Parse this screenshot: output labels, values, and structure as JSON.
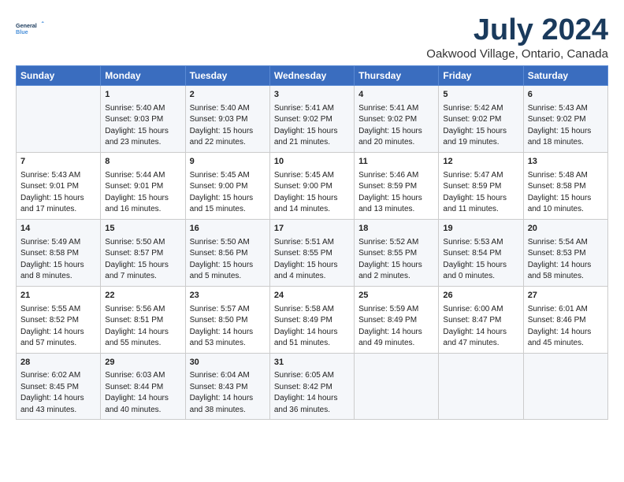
{
  "logo": {
    "line1": "General",
    "line2": "Blue"
  },
  "title": "July 2024",
  "subtitle": "Oakwood Village, Ontario, Canada",
  "headers": [
    "Sunday",
    "Monday",
    "Tuesday",
    "Wednesday",
    "Thursday",
    "Friday",
    "Saturday"
  ],
  "weeks": [
    [
      {
        "day": "",
        "lines": []
      },
      {
        "day": "1",
        "lines": [
          "Sunrise: 5:40 AM",
          "Sunset: 9:03 PM",
          "Daylight: 15 hours",
          "and 23 minutes."
        ]
      },
      {
        "day": "2",
        "lines": [
          "Sunrise: 5:40 AM",
          "Sunset: 9:03 PM",
          "Daylight: 15 hours",
          "and 22 minutes."
        ]
      },
      {
        "day": "3",
        "lines": [
          "Sunrise: 5:41 AM",
          "Sunset: 9:02 PM",
          "Daylight: 15 hours",
          "and 21 minutes."
        ]
      },
      {
        "day": "4",
        "lines": [
          "Sunrise: 5:41 AM",
          "Sunset: 9:02 PM",
          "Daylight: 15 hours",
          "and 20 minutes."
        ]
      },
      {
        "day": "5",
        "lines": [
          "Sunrise: 5:42 AM",
          "Sunset: 9:02 PM",
          "Daylight: 15 hours",
          "and 19 minutes."
        ]
      },
      {
        "day": "6",
        "lines": [
          "Sunrise: 5:43 AM",
          "Sunset: 9:02 PM",
          "Daylight: 15 hours",
          "and 18 minutes."
        ]
      }
    ],
    [
      {
        "day": "7",
        "lines": [
          "Sunrise: 5:43 AM",
          "Sunset: 9:01 PM",
          "Daylight: 15 hours",
          "and 17 minutes."
        ]
      },
      {
        "day": "8",
        "lines": [
          "Sunrise: 5:44 AM",
          "Sunset: 9:01 PM",
          "Daylight: 15 hours",
          "and 16 minutes."
        ]
      },
      {
        "day": "9",
        "lines": [
          "Sunrise: 5:45 AM",
          "Sunset: 9:00 PM",
          "Daylight: 15 hours",
          "and 15 minutes."
        ]
      },
      {
        "day": "10",
        "lines": [
          "Sunrise: 5:45 AM",
          "Sunset: 9:00 PM",
          "Daylight: 15 hours",
          "and 14 minutes."
        ]
      },
      {
        "day": "11",
        "lines": [
          "Sunrise: 5:46 AM",
          "Sunset: 8:59 PM",
          "Daylight: 15 hours",
          "and 13 minutes."
        ]
      },
      {
        "day": "12",
        "lines": [
          "Sunrise: 5:47 AM",
          "Sunset: 8:59 PM",
          "Daylight: 15 hours",
          "and 11 minutes."
        ]
      },
      {
        "day": "13",
        "lines": [
          "Sunrise: 5:48 AM",
          "Sunset: 8:58 PM",
          "Daylight: 15 hours",
          "and 10 minutes."
        ]
      }
    ],
    [
      {
        "day": "14",
        "lines": [
          "Sunrise: 5:49 AM",
          "Sunset: 8:58 PM",
          "Daylight: 15 hours",
          "and 8 minutes."
        ]
      },
      {
        "day": "15",
        "lines": [
          "Sunrise: 5:50 AM",
          "Sunset: 8:57 PM",
          "Daylight: 15 hours",
          "and 7 minutes."
        ]
      },
      {
        "day": "16",
        "lines": [
          "Sunrise: 5:50 AM",
          "Sunset: 8:56 PM",
          "Daylight: 15 hours",
          "and 5 minutes."
        ]
      },
      {
        "day": "17",
        "lines": [
          "Sunrise: 5:51 AM",
          "Sunset: 8:55 PM",
          "Daylight: 15 hours",
          "and 4 minutes."
        ]
      },
      {
        "day": "18",
        "lines": [
          "Sunrise: 5:52 AM",
          "Sunset: 8:55 PM",
          "Daylight: 15 hours",
          "and 2 minutes."
        ]
      },
      {
        "day": "19",
        "lines": [
          "Sunrise: 5:53 AM",
          "Sunset: 8:54 PM",
          "Daylight: 15 hours",
          "and 0 minutes."
        ]
      },
      {
        "day": "20",
        "lines": [
          "Sunrise: 5:54 AM",
          "Sunset: 8:53 PM",
          "Daylight: 14 hours",
          "and 58 minutes."
        ]
      }
    ],
    [
      {
        "day": "21",
        "lines": [
          "Sunrise: 5:55 AM",
          "Sunset: 8:52 PM",
          "Daylight: 14 hours",
          "and 57 minutes."
        ]
      },
      {
        "day": "22",
        "lines": [
          "Sunrise: 5:56 AM",
          "Sunset: 8:51 PM",
          "Daylight: 14 hours",
          "and 55 minutes."
        ]
      },
      {
        "day": "23",
        "lines": [
          "Sunrise: 5:57 AM",
          "Sunset: 8:50 PM",
          "Daylight: 14 hours",
          "and 53 minutes."
        ]
      },
      {
        "day": "24",
        "lines": [
          "Sunrise: 5:58 AM",
          "Sunset: 8:49 PM",
          "Daylight: 14 hours",
          "and 51 minutes."
        ]
      },
      {
        "day": "25",
        "lines": [
          "Sunrise: 5:59 AM",
          "Sunset: 8:49 PM",
          "Daylight: 14 hours",
          "and 49 minutes."
        ]
      },
      {
        "day": "26",
        "lines": [
          "Sunrise: 6:00 AM",
          "Sunset: 8:47 PM",
          "Daylight: 14 hours",
          "and 47 minutes."
        ]
      },
      {
        "day": "27",
        "lines": [
          "Sunrise: 6:01 AM",
          "Sunset: 8:46 PM",
          "Daylight: 14 hours",
          "and 45 minutes."
        ]
      }
    ],
    [
      {
        "day": "28",
        "lines": [
          "Sunrise: 6:02 AM",
          "Sunset: 8:45 PM",
          "Daylight: 14 hours",
          "and 43 minutes."
        ]
      },
      {
        "day": "29",
        "lines": [
          "Sunrise: 6:03 AM",
          "Sunset: 8:44 PM",
          "Daylight: 14 hours",
          "and 40 minutes."
        ]
      },
      {
        "day": "30",
        "lines": [
          "Sunrise: 6:04 AM",
          "Sunset: 8:43 PM",
          "Daylight: 14 hours",
          "and 38 minutes."
        ]
      },
      {
        "day": "31",
        "lines": [
          "Sunrise: 6:05 AM",
          "Sunset: 8:42 PM",
          "Daylight: 14 hours",
          "and 36 minutes."
        ]
      },
      {
        "day": "",
        "lines": []
      },
      {
        "day": "",
        "lines": []
      },
      {
        "day": "",
        "lines": []
      }
    ]
  ]
}
